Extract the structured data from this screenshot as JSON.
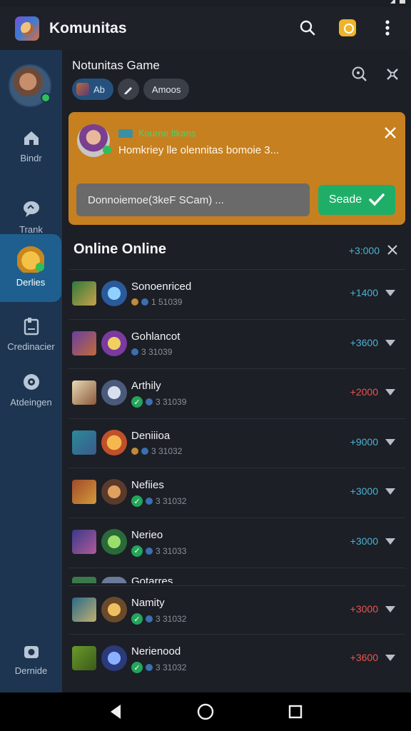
{
  "app": {
    "title": "Komunitas"
  },
  "rail": {
    "items": [
      {
        "label": "Bindr",
        "icon": "home-icon"
      },
      {
        "label": "Trank",
        "icon": "chat-icon"
      },
      {
        "label": "Derlies",
        "icon": "game-hero-icon",
        "active": true
      },
      {
        "label": "Credinacier",
        "icon": "clipboard-icon"
      },
      {
        "label": "Atdeingen",
        "icon": "target-icon"
      }
    ],
    "bottom": {
      "label": "Dernide",
      "icon": "camera-icon"
    }
  },
  "group": {
    "title": "Notunitas Game",
    "chips": [
      "Ab",
      "",
      "Amoos"
    ]
  },
  "notice": {
    "tag": "Kourne Itkans",
    "text": "Homkriey lle olennitas bomoie 3...",
    "input_value": "Donnoiemoe(3keF SCam) ...",
    "send_label": "Seade"
  },
  "online": {
    "title": "Online Online",
    "count": "+3:000"
  },
  "players": [
    {
      "name": "Sonoenriced",
      "meta": "1 51039",
      "score": "+1400",
      "score_color": "blue",
      "badge": "coin"
    },
    {
      "name": "Gohlancot",
      "meta": "3 31039",
      "score": "+3600",
      "score_color": "blue",
      "badge": "dot"
    },
    {
      "name": "Arthily",
      "meta": "3 31039",
      "score": "+2000",
      "score_color": "red",
      "badge": "check"
    },
    {
      "name": "Deniiioa",
      "meta": "3 31032",
      "score": "+9000",
      "score_color": "blue",
      "badge": "coin"
    },
    {
      "name": "Nefiies",
      "meta": "3 31032",
      "score": "+3000",
      "score_color": "blue",
      "badge": "check"
    },
    {
      "name": "Nerieo",
      "meta": "3 31033",
      "score": "+3000",
      "score_color": "blue",
      "badge": "check"
    }
  ],
  "partial_player": {
    "name": "Gotarres"
  },
  "players_lower": [
    {
      "name": "Namity",
      "meta": "3 31032",
      "score": "+3000",
      "score_color": "red",
      "badge": "check"
    },
    {
      "name": "Nerienood",
      "meta": "3 31032",
      "score": "+3600",
      "score_color": "red",
      "badge": "check"
    }
  ],
  "colors": {
    "rail_bg": "#1d3550",
    "rail_active": "#1f5f8f",
    "notice_bg": "#c7801f",
    "send_bg": "#1fae68",
    "accent_blue": "#49b3d6",
    "accent_red": "#ef5350"
  }
}
